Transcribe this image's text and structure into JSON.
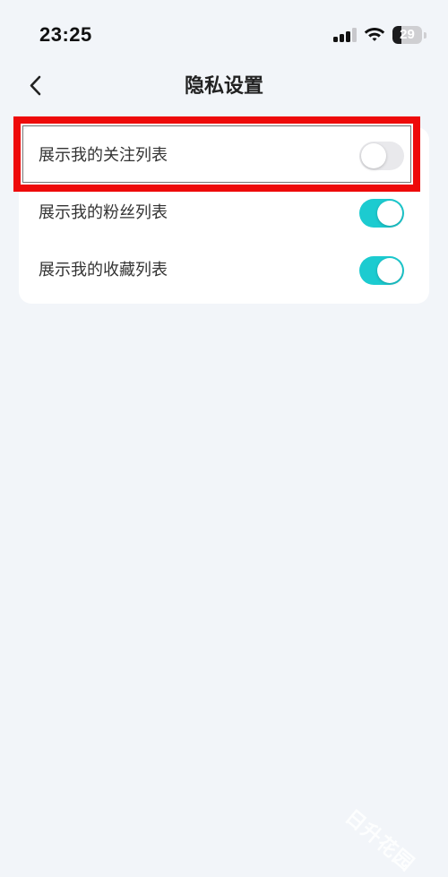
{
  "status_bar": {
    "time": "23:25",
    "battery_level": "29",
    "battery_fraction": 0.29,
    "signal_bars": 3,
    "signal_icon": "cellular-signal-icon",
    "wifi_icon": "wifi-icon",
    "battery_icon": "battery-icon"
  },
  "nav": {
    "back_icon": "chevron-left-icon",
    "title": "隐私设置"
  },
  "settings": {
    "items": [
      {
        "label": "展示我的关注列表",
        "enabled": false
      },
      {
        "label": "展示我的粉丝列表",
        "enabled": true
      },
      {
        "label": "展示我的收藏列表",
        "enabled": true
      }
    ]
  },
  "watermark": "日升花园",
  "colors": {
    "toggle_on": "#1ccbd0",
    "toggle_off": "#e9e9ec",
    "highlight": "#ee0a0a",
    "background": "#f2f5f9"
  }
}
